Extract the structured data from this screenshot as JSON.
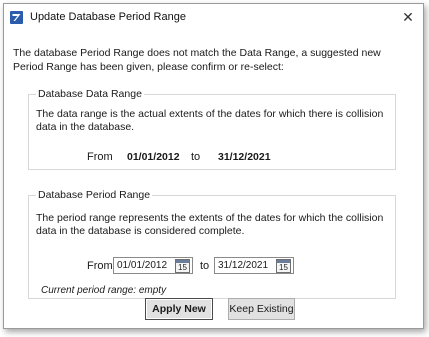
{
  "window": {
    "title": "Update Database Period Range",
    "close_glyph": "✕"
  },
  "message": "The database Period Range does not match the Data Range, a suggested new Period Range has been given, please confirm or re-select:",
  "data_range": {
    "legend": "Database Data Range",
    "description": "The data range is the actual extents of the dates for which there is collision data in the database.",
    "from_label": "From",
    "from_value": "01/01/2012",
    "to_label": "to",
    "to_value": "31/12/2021"
  },
  "period_range": {
    "legend": "Database Period Range",
    "description": "The period range represents the extents of the dates for which the collision data in the database is considered complete.",
    "from_label": "From",
    "from_value": "01/01/2012",
    "to_label": "to",
    "to_value": "31/12/2021",
    "calendar_day": "15",
    "current_text": "Current period range: empty"
  },
  "buttons": {
    "apply": "Apply New",
    "keep": "Keep Existing"
  },
  "icons": {
    "app": "app-logo-icon",
    "close": "close-icon",
    "calendar": "calendar-icon"
  },
  "colors": {
    "app_icon": "#2b5bab",
    "border": "#9a9a9a"
  }
}
